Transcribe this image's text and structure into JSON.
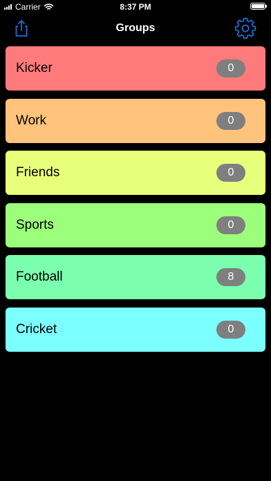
{
  "status_bar": {
    "carrier": "Carrier",
    "time": "8:37 PM"
  },
  "nav": {
    "title": "Groups",
    "left_icon": "share-icon",
    "right_icon": "gear-icon",
    "accent_color": "#1a6fe0"
  },
  "groups": [
    {
      "name": "Kicker",
      "count": "0",
      "color": "#ff7b7b"
    },
    {
      "name": "Work",
      "count": "0",
      "color": "#ffc37b"
    },
    {
      "name": "Friends",
      "count": "0",
      "color": "#e8ff7b"
    },
    {
      "name": "Sports",
      "count": "0",
      "color": "#9cff7b"
    },
    {
      "name": "Football",
      "count": "8",
      "color": "#7bffaf"
    },
    {
      "name": "Cricket",
      "count": "0",
      "color": "#7bffff"
    }
  ]
}
